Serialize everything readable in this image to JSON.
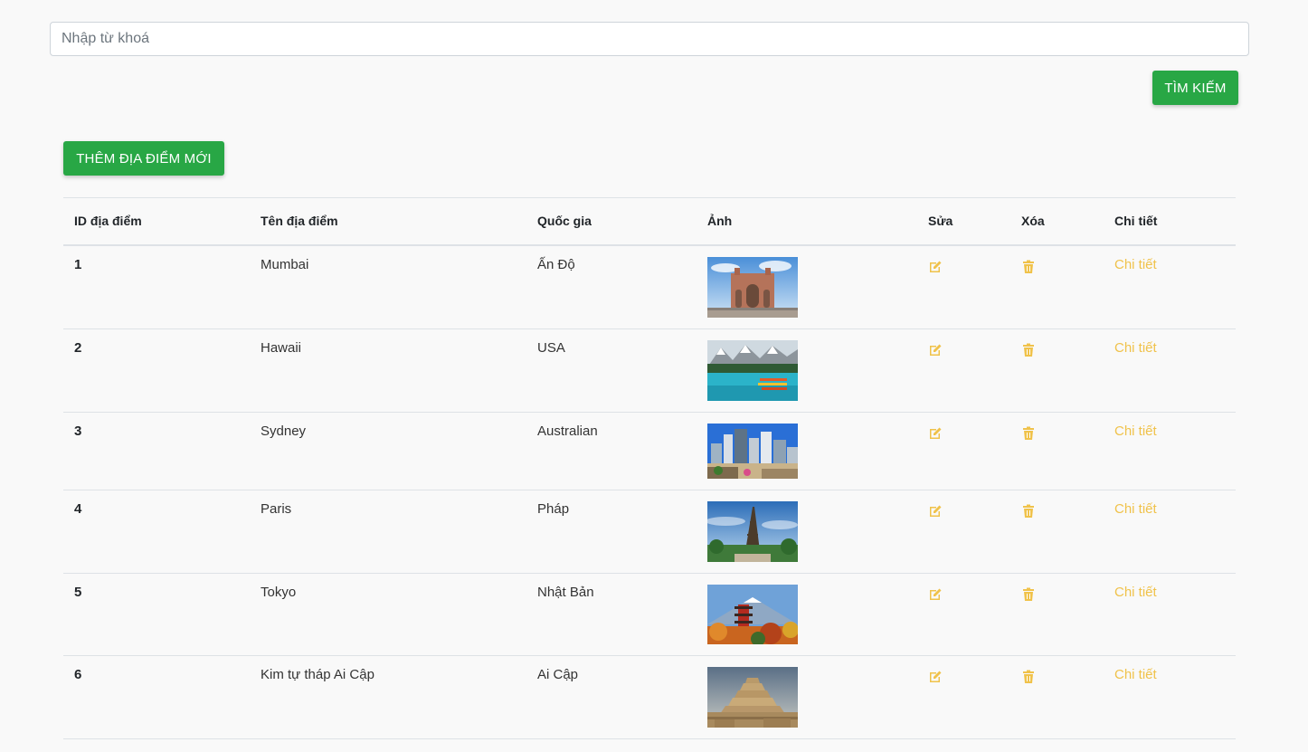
{
  "search": {
    "placeholder": "Nhập từ khoá",
    "value": "",
    "button_label": "TÌM KIẾM"
  },
  "add_button_label": "THÊM ĐỊA ĐIỂM MỚI",
  "table": {
    "headers": [
      "ID địa điểm",
      "Tên địa điểm",
      "Quốc gia",
      "Ảnh",
      "Sửa",
      "Xóa",
      "Chi tiết"
    ],
    "rows": [
      {
        "id": "1",
        "name": "Mumbai",
        "country": "Ấn Độ",
        "image": "gateway-of-india-photo",
        "detail": "Chi tiết"
      },
      {
        "id": "2",
        "name": "Hawaii",
        "country": "USA",
        "image": "mountain-lake-canoes-photo",
        "detail": "Chi tiết"
      },
      {
        "id": "3",
        "name": "Sydney",
        "country": "Australian",
        "image": "city-skyline-photo",
        "detail": "Chi tiết"
      },
      {
        "id": "4",
        "name": "Paris",
        "country": "Pháp",
        "image": "eiffel-tower-photo",
        "detail": "Chi tiết"
      },
      {
        "id": "5",
        "name": "Tokyo",
        "country": "Nhật Bản",
        "image": "pagoda-mount-fuji-photo",
        "detail": "Chi tiết"
      },
      {
        "id": "6",
        "name": "Kim tự tháp Ai Cập",
        "country": "Ai Cập",
        "image": "step-pyramid-photo",
        "detail": "Chi tiết"
      }
    ]
  },
  "icons": {
    "edit": "edit-icon",
    "delete": "trash-icon"
  },
  "colors": {
    "primary_button": "#28a745",
    "action_icon": "#f0c24a",
    "background": "#f9f9f9"
  }
}
